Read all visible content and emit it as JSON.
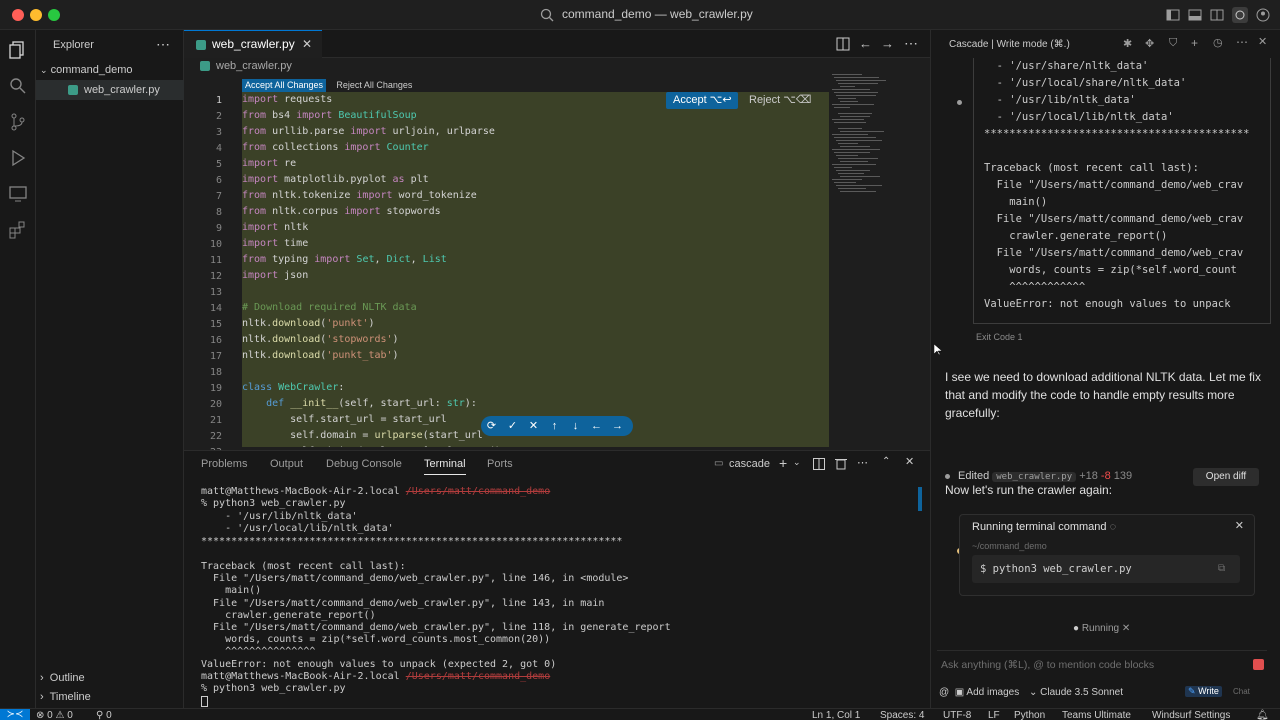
{
  "window": {
    "title": "command_demo — web_crawler.py"
  },
  "sidebar": {
    "header": "Explorer",
    "folder": "command_demo",
    "file": "web_crawler.py",
    "sections": [
      "Outline",
      "Timeline"
    ]
  },
  "editor": {
    "tab_label": "web_crawler.py",
    "breadcrumb": "web_crawler.py",
    "accept_all_label": "Accept All Changes",
    "reject_all_label": "Reject All Changes",
    "accept_label": "Accept ⌥↩",
    "reject_label": "Reject ⌥⌫",
    "lines": [
      "import requests",
      "from bs4 import BeautifulSoup",
      "from urllib.parse import urljoin, urlparse",
      "from collections import Counter",
      "import re",
      "import matplotlib.pyplot as plt",
      "from nltk.tokenize import word_tokenize",
      "from nltk.corpus import stopwords",
      "import nltk",
      "import time",
      "from typing import Set, Dict, List",
      "import json",
      "",
      "# Download required NLTK data",
      "nltk.download('punkt')",
      "nltk.download('stopwords')",
      "nltk.download('punkt_tab')",
      "",
      "class WebCrawler:",
      "    def __init__(self, start_url: str):",
      "        self.start_url = start_url",
      "        self.domain = urlparse(start_url",
      "        self.visited_urls: Set[str] = set()"
    ]
  },
  "panel": {
    "tabs": [
      "Problems",
      "Output",
      "Debug Console",
      "Terminal",
      "Ports"
    ],
    "active_tab": "Terminal",
    "terminal_name": "cascade",
    "lines": [
      "matt@Matthews-MacBook-Air-2.local",
      "% python3 web_crawler.py",
      "    - '/usr/lib/nltk_data'",
      "    - '/usr/local/lib/nltk_data'",
      "**********************************************************************",
      "",
      "Traceback (most recent call last):",
      "  File \"/Users/matt/command_demo/web_crawler.py\", line 146, in <module>",
      "    main()",
      "  File \"/Users/matt/command_demo/web_crawler.py\", line 143, in main",
      "    crawler.generate_report()",
      "  File \"/Users/matt/command_demo/web_crawler.py\", line 118, in generate_report",
      "    words, counts = zip(*self.word_counts.most_common(20))",
      "    ^^^^^^^^^^^^^^^",
      "ValueError: not enough values to unpack (expected 2, got 0)",
      "matt@Matthews-MacBook-Air-2.local",
      "% python3 web_crawler.py"
    ],
    "struck_path": "/Users/matt/command_demo"
  },
  "cascade": {
    "header": "Cascade | Write mode (⌘.)",
    "output_lines": [
      "  - '/usr/share/nltk_data'",
      "  - '/usr/local/share/nltk_data'",
      "  - '/usr/lib/nltk_data'",
      "  - '/usr/local/lib/nltk_data'",
      "******************************************",
      "",
      "Traceback (most recent call last):",
      "  File \"/Users/matt/command_demo/web_crav",
      "    main()",
      "  File \"/Users/matt/command_demo/web_crav",
      "    crawler.generate_report()",
      "  File \"/Users/matt/command_demo/web_crav",
      "    words, counts = zip(*self.word_count",
      "    ^^^^^^^^^^^^",
      "ValueError: not enough values to unpack"
    ],
    "exit_code": "Exit Code 1",
    "message1": "I see we need to download additional NLTK data. Let me fix that and modify the code to handle empty results more gracefully:",
    "edited_label": "Edited",
    "edited_file": "web_crawler.py",
    "additions": "+18",
    "deletions": "-8",
    "line_ref": "139",
    "open_diff": "Open diff",
    "message2": "Now let's run the crawler again:",
    "run_title": "Running terminal command",
    "run_cwd": "~/command_demo",
    "run_cmd": "$ python3 web_crawler.py",
    "running_label": "Running",
    "input_placeholder": "Ask anything (⌘L), @ to mention code blocks",
    "add_images": "Add images",
    "model": "Claude 3.5 Sonnet",
    "write": "Write",
    "chat": "Chat"
  },
  "status": {
    "errors": "0",
    "warnings": "0",
    "ports": "0",
    "position": "Ln 1, Col 1",
    "spaces": "Spaces: 4",
    "encoding": "UTF-8",
    "eol": "LF",
    "language": "Python",
    "plan": "Teams Ultimate",
    "settings": "Windsurf Settings"
  },
  "colors": {
    "accent": "#0078d4",
    "diff_bg": "#3b4127",
    "button": "#0e639c"
  }
}
